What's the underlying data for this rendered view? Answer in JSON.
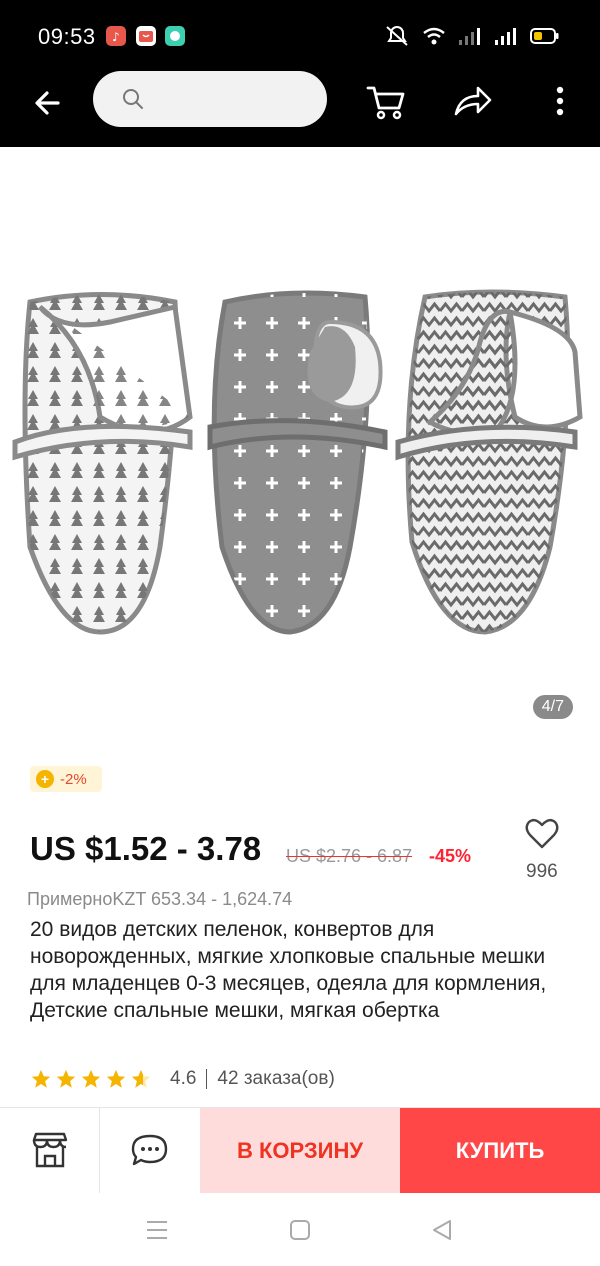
{
  "status_bar": {
    "time": "09:53",
    "apps": [
      {
        "icon": "music-app-icon",
        "color": "#e8574b"
      },
      {
        "icon": "shopping-app-icon",
        "color": "#e8574b"
      },
      {
        "icon": "chat-app-icon",
        "color": "#3ccfb0"
      }
    ],
    "battery_color": "#f5c400"
  },
  "header": {
    "search_placeholder": ""
  },
  "gallery": {
    "counter": "4/7"
  },
  "product": {
    "coupon": "-2%",
    "price": "US $1.52 - 3.78",
    "old_price": "US $2.76 - 6.87",
    "discount": "-45%",
    "wishlist_count": "996",
    "approx_price": "ПримерноKZT 653.34 - 1,624.74",
    "title": "20 видов детских пеленок, конвертов для новорожденных, мягкие хлопковые спальные мешки для младенцев 0-3 месяцев, одеяла для кормления, Детские спальные мешки, мягкая обертка",
    "rating": "4.6",
    "orders": "42 заказа(ов)"
  },
  "actions": {
    "add_to_cart": "В КОРЗИНУ",
    "buy": "КУПИТЬ"
  },
  "colors": {
    "accent": "#ff4747",
    "cart_bg": "#ffdcdc",
    "star": "#f5b400"
  }
}
